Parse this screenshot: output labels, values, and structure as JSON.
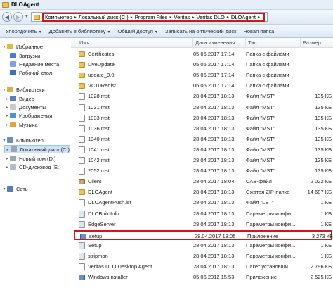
{
  "window": {
    "title": "DLOAgent"
  },
  "address": {
    "crumbs": [
      "Компьютер",
      "Локальный диск (C:)",
      "Program Files",
      "Veritas",
      "Veritas DLO",
      "DLOAgent"
    ]
  },
  "toolbar": {
    "items": [
      {
        "label": "Упорядочить",
        "dropdown": true
      },
      {
        "label": "Добавить в библиотеку",
        "dropdown": true
      },
      {
        "label": "Общий доступ",
        "dropdown": true
      },
      {
        "label": "Записать на оптический диск",
        "dropdown": false
      },
      {
        "label": "Новая папка",
        "dropdown": false
      }
    ]
  },
  "sidebar": {
    "items": [
      {
        "label": "Избранное",
        "icon": "star-icon",
        "color": "#e8b83a",
        "indent": 0,
        "expand": true
      },
      {
        "label": "Загрузки",
        "icon": "downloads-icon",
        "color": "#4d7bc4",
        "indent": 1
      },
      {
        "label": "Недавние места",
        "icon": "recent-places-icon",
        "color": "#7aa3d6",
        "indent": 1
      },
      {
        "label": "Рабочий стол",
        "icon": "desktop-icon",
        "color": "#3f6fb5",
        "indent": 1
      },
      {
        "label": "Библиотеки",
        "icon": "libraries-icon",
        "color": "#d9b04a",
        "indent": 0,
        "expand": true
      },
      {
        "label": "Видео",
        "icon": "video-icon",
        "color": "#5b7fb6",
        "indent": 1,
        "expand": true
      },
      {
        "label": "Документы",
        "icon": "documents-icon",
        "color": "#c9c9c9",
        "indent": 1,
        "expand": true
      },
      {
        "label": "Изображения",
        "icon": "pictures-icon",
        "color": "#4f94c8",
        "indent": 1,
        "expand": true
      },
      {
        "label": "Музыка",
        "icon": "music-icon",
        "color": "#e0a33a",
        "indent": 1,
        "expand": true
      },
      {
        "label": "Компьютер",
        "icon": "computer-icon",
        "color": "#6e8fb8",
        "indent": 0,
        "expand": true
      },
      {
        "label": "Локальный диск (C:)",
        "icon": "drive-icon",
        "color": "#9aa7b6",
        "indent": 1,
        "expand": true,
        "selected": true
      },
      {
        "label": "Новый том (D:)",
        "icon": "drive-icon",
        "color": "#9aa7b6",
        "indent": 1,
        "expand": true
      },
      {
        "label": "CD-дисковод (E:)",
        "icon": "cd-drive-icon",
        "color": "#b4bcc6",
        "indent": 1,
        "expand": true
      },
      {
        "label": "Сеть",
        "icon": "network-icon",
        "color": "#4f7fbf",
        "indent": 0,
        "expand": true
      }
    ]
  },
  "columns": [
    "Имя",
    "Дата изменения",
    "Тип",
    "Размер"
  ],
  "files": [
    {
      "name": "Certificates",
      "date": "05.06.2017 17:14",
      "type": "Папка с файлами",
      "size": "",
      "kind": "folder"
    },
    {
      "name": "LiveUpdate",
      "date": "05.06.2017 17:14",
      "type": "Папка с файлами",
      "size": "",
      "kind": "folder"
    },
    {
      "name": "update_9.0",
      "date": "05.06.2017 17:14",
      "type": "Папка с файлами",
      "size": "",
      "kind": "folder"
    },
    {
      "name": "VC10Redist",
      "date": "05.06.2017 17:14",
      "type": "Папка с файлами",
      "size": "",
      "kind": "folder"
    },
    {
      "name": "1028.mst",
      "date": "28.04.2017 18:13",
      "type": "Файл \"MST\"",
      "size": "135 КБ",
      "kind": "file"
    },
    {
      "name": "1031.mst",
      "date": "28.04.2017 18:13",
      "type": "Файл \"MST\"",
      "size": "135 КБ",
      "kind": "file"
    },
    {
      "name": "1033.mst",
      "date": "28.04.2017 18:13",
      "type": "Файл \"MST\"",
      "size": "135 КБ",
      "kind": "file"
    },
    {
      "name": "1036.mst",
      "date": "28.04.2017 18:13",
      "type": "Файл \"MST\"",
      "size": "135 КБ",
      "kind": "file"
    },
    {
      "name": "1040.mst",
      "date": "28.04.2017 18:13",
      "type": "Файл \"MST\"",
      "size": "135 КБ",
      "kind": "file"
    },
    {
      "name": "1041.mst",
      "date": "28.04.2017 18:13",
      "type": "Файл \"MST\"",
      "size": "135 КБ",
      "kind": "file"
    },
    {
      "name": "1042.mst",
      "date": "28.04.2017 18:13",
      "type": "Файл \"MST\"",
      "size": "135 КБ",
      "kind": "file"
    },
    {
      "name": "2052.mst",
      "date": "28.04.2017 18:13",
      "type": "Файл \"MST\"",
      "size": "135 КБ",
      "kind": "file"
    },
    {
      "name": "Client",
      "date": "28.04.2017 18:04",
      "type": "CAB-файл",
      "size": "2 022 КБ",
      "kind": "cab"
    },
    {
      "name": "DLOAgent",
      "date": "28.04.2017 18:13",
      "type": "Сжатая ZIP-папка",
      "size": "14 687 КБ",
      "kind": "zip"
    },
    {
      "name": "DLOAgentPush.lst",
      "date": "28.04.2017 18:13",
      "type": "Файл \"LST\"",
      "size": "1 КБ",
      "kind": "file"
    },
    {
      "name": "DLOBuildInfo",
      "date": "28.04.2017 18:13",
      "type": "Параметры конфи...",
      "size": "1 КБ",
      "kind": "cfg"
    },
    {
      "name": "EdgeServer",
      "date": "28.04.2017 18:13",
      "type": "Параметры конфи...",
      "size": "1 КБ",
      "kind": "cfg"
    },
    {
      "name": "setup",
      "date": "28.04.2017 18:05",
      "type": "Приложение",
      "size": "3 273 КБ",
      "kind": "app",
      "highlighted": true
    },
    {
      "name": "Setup",
      "date": "28.04.2017 18:13",
      "type": "Параметры конфи...",
      "size": "1 КБ",
      "kind": "cfg"
    },
    {
      "name": "stripmon",
      "date": "28.04.2017 18:13",
      "type": "Параметры конфи...",
      "size": "1 КБ",
      "kind": "cfg"
    },
    {
      "name": "Veritas DLO Desktop Agent",
      "date": "28.04.2017 18:13",
      "type": "Пакет установщи...",
      "size": "2 796 КБ",
      "kind": "file"
    },
    {
      "name": "WindowsInstaller",
      "date": "05.06.2012 15:53",
      "type": "Приложение",
      "size": "2 525 КБ",
      "kind": "app"
    }
  ]
}
